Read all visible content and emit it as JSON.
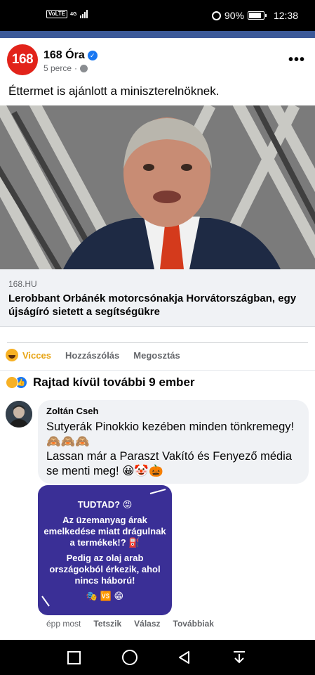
{
  "status_bar": {
    "volte": "VoLTE",
    "network": "4G",
    "battery": "90%",
    "battery_level": 0.9,
    "time": "12:38"
  },
  "post": {
    "page_avatar_text": "168",
    "page_name": "168 Óra",
    "time_ago": "5 perce",
    "separator": "·",
    "text": "Éttermet is ajánlott a miniszterelnöknek.",
    "more_label": "•••",
    "link": {
      "domain": "168.HU",
      "title": "Lerobbant Orbánék motorcsónakja Horvátországban, egy újságíró sietett a segítségükre"
    }
  },
  "actions": {
    "reaction_label": "Vicces",
    "comment_label": "Hozzászólás",
    "share_label": "Megosztás"
  },
  "reactions_summary": "Rajtad kívül további 9 ember",
  "comment": {
    "author": "Zoltán Cseh",
    "text_line1": "Sutyerák Pinokkio kezében minden tönkremegy! 🙈🙈🙈",
    "text_line2": "Lassan már a Paraszt Vakító és Fenyező média se menti meg! 😀🤡🎃",
    "attachment": {
      "line1": "TUDTAD? 😡",
      "line2": "Az üzemanyag árak emelkedése miatt drágulnak a termékek!? ⛽",
      "line3": "Pedig az olaj arab országokból érkezik, ahol nincs háború!",
      "line4": "🎭 🆚 😁"
    },
    "time": "épp most",
    "like_label": "Tetszik",
    "reply_label": "Válasz",
    "more_label": "Továbbiak"
  }
}
